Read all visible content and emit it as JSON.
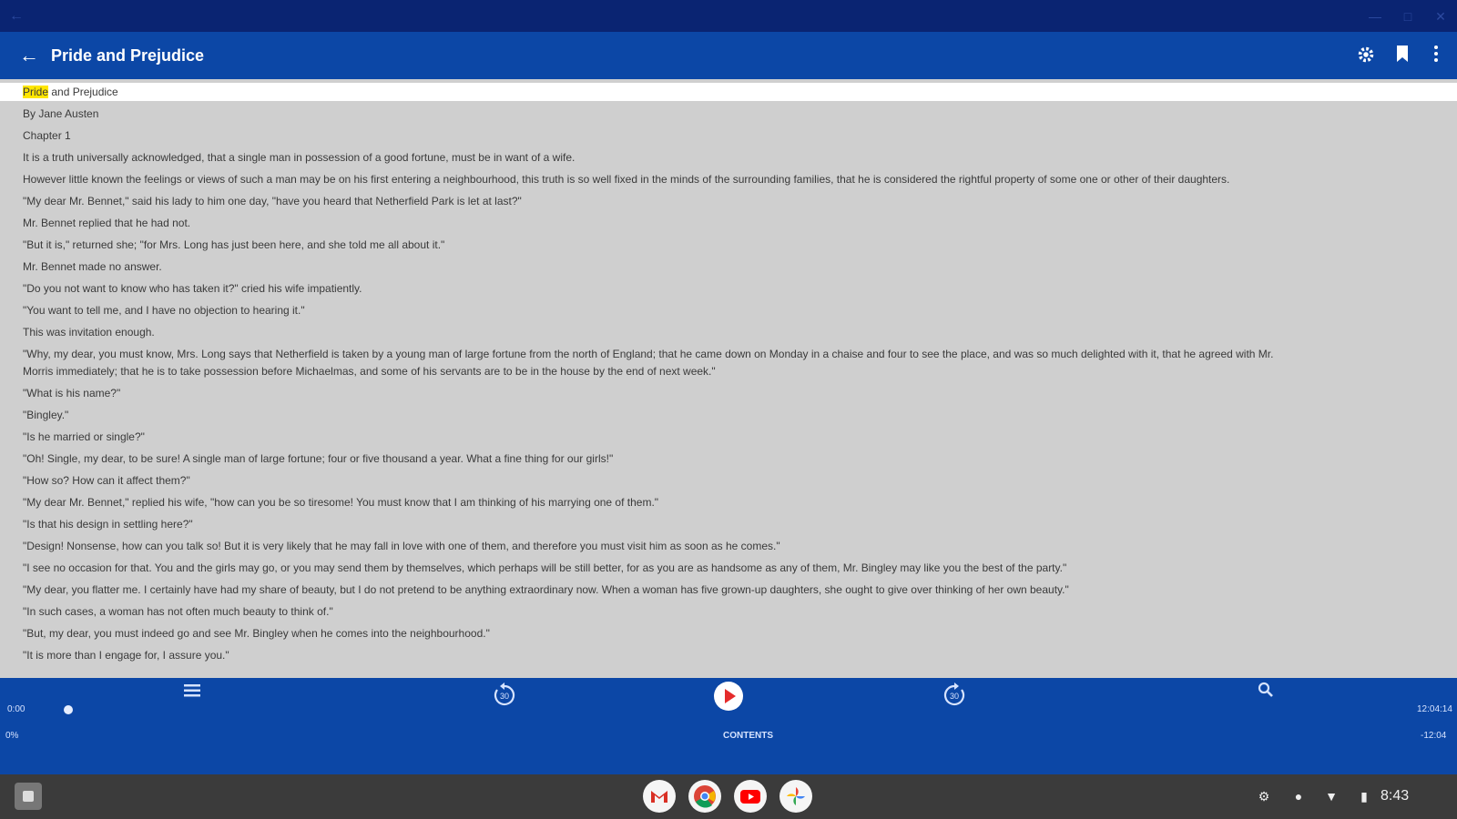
{
  "window": {
    "controls": [
      "minimize",
      "maximize",
      "close"
    ]
  },
  "appbar": {
    "title": "Pride and Prejudice",
    "icons": [
      "back-arrow-icon",
      "gear-icon",
      "bookmark-icon",
      "more-vert-icon"
    ]
  },
  "book": {
    "highlight": "Pride",
    "title_rest": " and Prejudice",
    "lines": [
      "By Jane Austen",
      "Chapter 1",
      "It is a truth universally acknowledged, that a single man in possession of a good fortune, must be in want of a wife.",
      "However little known the feelings or views of such a man may be on his first entering a neighbourhood, this truth is so well fixed in the minds of the surrounding families, that he is considered the rightful property of some one or other of their daughters.",
      "\"My dear Mr. Bennet,\" said his lady to him one day, \"have you heard that Netherfield Park is let at last?\"",
      "Mr. Bennet replied that he had not.",
      "\"But it is,\" returned she; \"for Mrs. Long has just been here, and she told me all about it.\"",
      "Mr. Bennet made no answer.",
      "\"Do you not want to know who has taken it?\" cried his wife impatiently.",
      "\"You want to tell me, and I have no objection to hearing it.\"",
      "This was invitation enough.",
      "\"Why, my dear, you must know, Mrs. Long says that Netherfield is taken by a young man of large fortune from the north of England; that he came down on Monday in a chaise and four to see the place, and was so much delighted with it, that he agreed with Mr.",
      "Morris immediately; that he is to take possession before Michaelmas, and some of his servants are to be in the house by the end of next week.\"",
      "\"What is his name?\"",
      "\"Bingley.\"",
      "\"Is he married or single?\"",
      "\"Oh! Single, my dear, to be sure! A single man of large fortune; four or five thousand a year. What a fine thing for our girls!\"",
      "\"How so? How can it affect them?\"",
      "\"My dear Mr. Bennet,\" replied his wife, \"how can you be so tiresome! You must know that I am thinking of his marrying one of them.\"",
      "\"Is that his design in settling here?\"",
      "\"Design! Nonsense, how can you talk so! But it is very likely that he may fall in love with one of them, and therefore you must visit him as soon as he comes.\"",
      "\"I see no occasion for that. You and the girls may go, or you may send them by themselves, which perhaps will be still better, for as you are as handsome as any of them, Mr. Bingley may like you the best of the party.\"",
      "\"My dear, you flatter me. I certainly have had my share of beauty, but I do not pretend to be anything extraordinary now. When a woman has five grown-up daughters, she ought to give over thinking of her own beauty.\"",
      "\"In such cases, a woman has not often much beauty to think of.\"",
      "\"But, my dear, you must indeed go and see Mr. Bingley when he comes into the neighbourhood.\"",
      "\"It is more than I engage for, I assure you.\""
    ]
  },
  "player": {
    "skip_back_label": "30",
    "skip_fwd_label": "30",
    "left_time": "0:00",
    "right_time": "12:04:14",
    "percent": "0%",
    "center_label": "CONTENTS",
    "right_label": "-12:04",
    "progress": 0.02,
    "icons": [
      "menu-icon",
      "replay-30-icon",
      "play-icon",
      "forward-30-icon",
      "search-icon"
    ]
  },
  "shelf": {
    "apps": [
      "gmail-icon",
      "chrome-icon",
      "youtube-icon",
      "photos-icon"
    ],
    "status_icons": [
      "settings-icon",
      "info-icon",
      "wifi-icon",
      "battery-icon"
    ],
    "clock": "8:43"
  },
  "colors": {
    "appbar": "#0c47a6",
    "chrome": "#0a2472",
    "highlight": "#ffe600",
    "page_bg": "#cfcfcf"
  }
}
